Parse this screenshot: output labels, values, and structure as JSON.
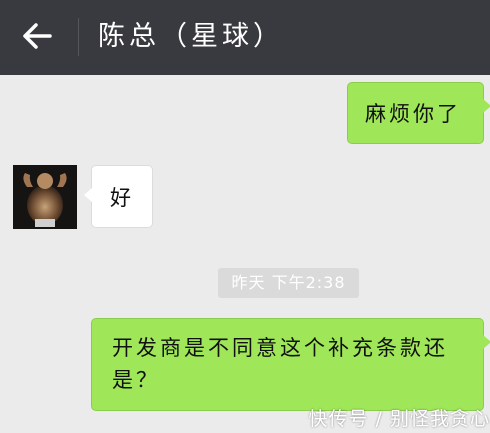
{
  "header": {
    "title": "陈总（星球）",
    "back_icon": "arrow-left-icon"
  },
  "messages": [
    {
      "side": "sent",
      "text": "麻烦你了"
    },
    {
      "side": "received",
      "text": "好"
    },
    {
      "side": "sent",
      "text": "开发商是不同意这个补充条款还是？"
    }
  ],
  "timestamp": "昨天 下午2:38",
  "watermark": "快传号 / 别怪我贪心",
  "colors": {
    "topbar": "#393a3f",
    "background": "#ebebeb",
    "sent_bubble": "#9fe658",
    "received_bubble": "#ffffff"
  }
}
